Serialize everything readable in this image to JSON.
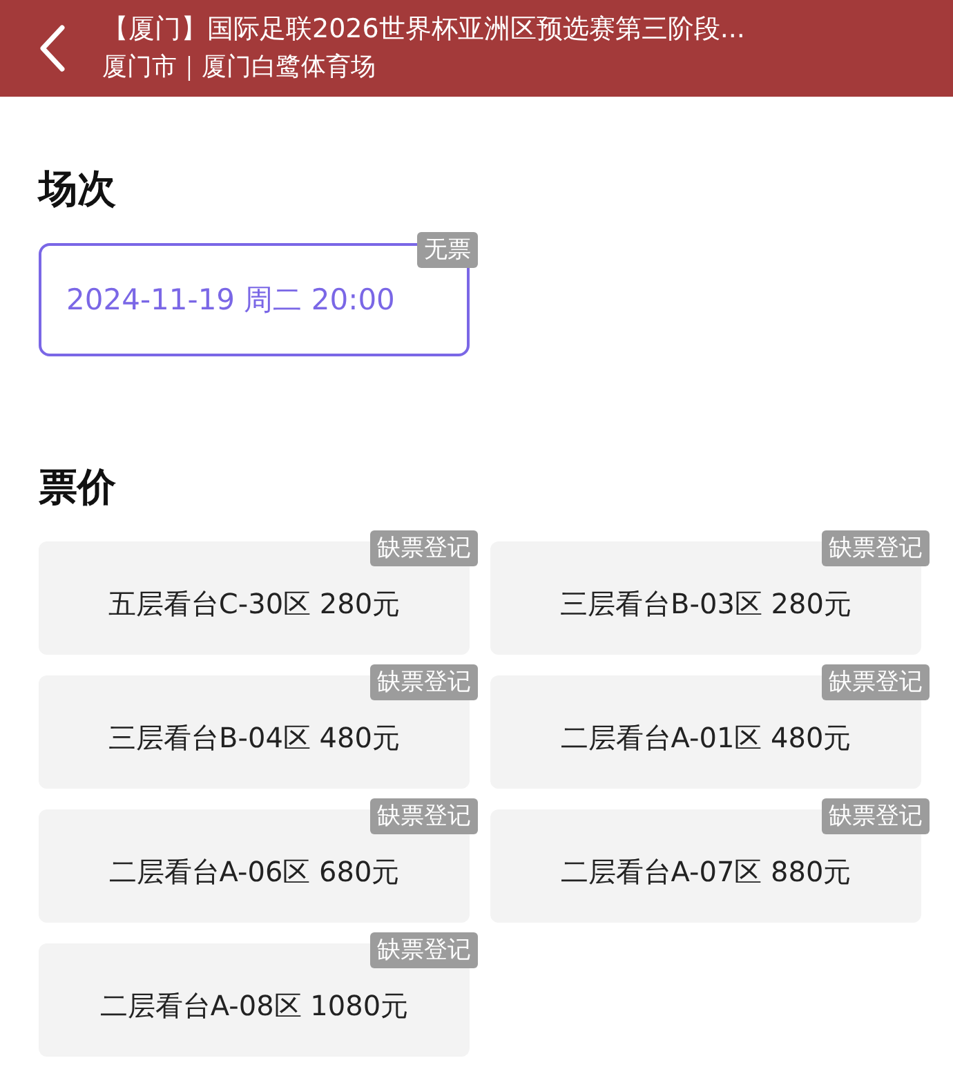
{
  "header": {
    "title": "【厦门】国际足联2026世界杯亚洲区预选赛第三阶段...",
    "subtitle": "厦门市｜厦门白鹭体育场"
  },
  "sessions": {
    "heading": "场次",
    "items": [
      {
        "label": "2024-11-19 周二 20:00",
        "badge": "无票",
        "selected": true
      }
    ]
  },
  "prices": {
    "heading": "票价",
    "items": [
      {
        "label": "五层看台C-30区 280元",
        "badge": "缺票登记"
      },
      {
        "label": "三层看台B-03区 280元",
        "badge": "缺票登记"
      },
      {
        "label": "三层看台B-04区 480元",
        "badge": "缺票登记"
      },
      {
        "label": "二层看台A-01区 480元",
        "badge": "缺票登记"
      },
      {
        "label": "二层看台A-06区 680元",
        "badge": "缺票登记"
      },
      {
        "label": "二层看台A-07区 880元",
        "badge": "缺票登记"
      },
      {
        "label": "二层看台A-08区 1080元",
        "badge": "缺票登记"
      }
    ]
  }
}
